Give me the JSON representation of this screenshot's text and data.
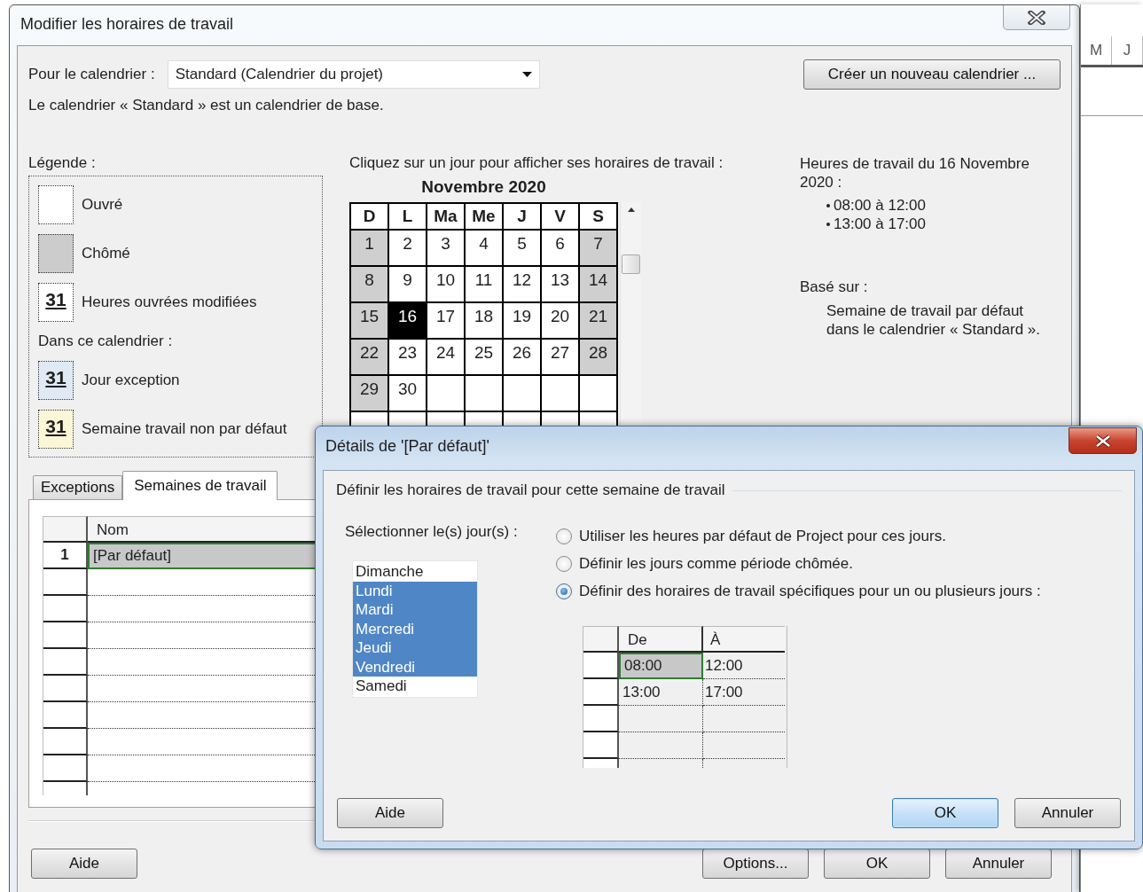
{
  "background_app": {
    "column_headers": [
      "M",
      "J"
    ]
  },
  "main_dialog": {
    "title": "Modifier les horaires de travail",
    "calendar_label": "Pour le calendrier :",
    "calendar_select": {
      "value": "Standard (Calendrier du projet)"
    },
    "new_calendar_button": "Créer un nouveau calendrier ...",
    "base_note": "Le calendrier « Standard » est un calendrier de base.",
    "legend": {
      "title": "Légende :",
      "items": [
        {
          "kind": "working",
          "label": "Ouvré"
        },
        {
          "kind": "nonworking",
          "label": "Chômé"
        },
        {
          "kind": "edited",
          "mark": "31",
          "label": "Heures ouvrées modifiées"
        },
        {
          "kind": "heading",
          "label": "Dans ce calendrier :"
        },
        {
          "kind": "exception",
          "mark": "31",
          "label": "Jour exception"
        },
        {
          "kind": "nondefault_week",
          "mark": "31",
          "label": "Semaine travail non par défaut"
        }
      ]
    },
    "calendar": {
      "prompt": "Cliquez sur un jour pour afficher ses horaires de travail :",
      "month": "Novembre 2020",
      "weekdays": [
        "D",
        "L",
        "Ma",
        "Me",
        "J",
        "V",
        "S"
      ],
      "weeks": [
        {
          "days": [
            {
              "day": "1",
              "nonworking": true,
              "selected": false
            },
            {
              "day": "2",
              "nonworking": false,
              "selected": false
            },
            {
              "day": "3",
              "nonworking": false,
              "selected": false
            },
            {
              "day": "4",
              "nonworking": false,
              "selected": false
            },
            {
              "day": "5",
              "nonworking": false,
              "selected": false
            },
            {
              "day": "6",
              "nonworking": false,
              "selected": false
            },
            {
              "day": "7",
              "nonworking": true,
              "selected": false
            }
          ]
        },
        {
          "days": [
            {
              "day": "8",
              "nonworking": true,
              "selected": false
            },
            {
              "day": "9",
              "nonworking": false,
              "selected": false
            },
            {
              "day": "10",
              "nonworking": false,
              "selected": false
            },
            {
              "day": "11",
              "nonworking": false,
              "selected": false
            },
            {
              "day": "12",
              "nonworking": false,
              "selected": false
            },
            {
              "day": "13",
              "nonworking": false,
              "selected": false
            },
            {
              "day": "14",
              "nonworking": true,
              "selected": false
            }
          ]
        },
        {
          "days": [
            {
              "day": "15",
              "nonworking": true,
              "selected": false
            },
            {
              "day": "16",
              "nonworking": false,
              "selected": true
            },
            {
              "day": "17",
              "nonworking": false,
              "selected": false
            },
            {
              "day": "18",
              "nonworking": false,
              "selected": false
            },
            {
              "day": "19",
              "nonworking": false,
              "selected": false
            },
            {
              "day": "20",
              "nonworking": false,
              "selected": false
            },
            {
              "day": "21",
              "nonworking": true,
              "selected": false
            }
          ]
        },
        {
          "days": [
            {
              "day": "22",
              "nonworking": true,
              "selected": false
            },
            {
              "day": "23",
              "nonworking": false,
              "selected": false
            },
            {
              "day": "24",
              "nonworking": false,
              "selected": false
            },
            {
              "day": "25",
              "nonworking": false,
              "selected": false
            },
            {
              "day": "26",
              "nonworking": false,
              "selected": false
            },
            {
              "day": "27",
              "nonworking": false,
              "selected": false
            },
            {
              "day": "28",
              "nonworking": true,
              "selected": false
            }
          ]
        },
        {
          "days": [
            {
              "day": "29",
              "nonworking": true,
              "selected": false
            },
            {
              "day": "30",
              "nonworking": false,
              "selected": false
            }
          ]
        }
      ]
    },
    "hours": {
      "title": "Heures de travail du 16 Novembre 2020 :",
      "ranges": [
        "08:00 à 12:00",
        "13:00 à 17:00"
      ],
      "based_on_label": "Basé sur :",
      "based_on": "Semaine de travail par défaut dans le calendrier « Standard »."
    },
    "tabs": [
      {
        "label": "Exceptions",
        "selected": false
      },
      {
        "label": "Semaines de travail",
        "selected": true
      }
    ],
    "table": {
      "columns": [
        "Nom"
      ],
      "rows": [
        {
          "number": "1",
          "name": "[Par défaut]",
          "selected": true
        }
      ]
    },
    "buttons": [
      {
        "label": "Aide",
        "default": false
      },
      {
        "label": "Options...",
        "default": false
      },
      {
        "label": "OK",
        "default": false
      },
      {
        "label": "Annuler",
        "default": false
      }
    ]
  },
  "details_dialog": {
    "title": "Détails de '[Par défaut]'",
    "group_title": "Définir les horaires de travail pour cette semaine de travail",
    "days_label": "Sélectionner le(s) jour(s) :",
    "days": [
      {
        "label": "Dimanche",
        "selected": false
      },
      {
        "label": "Lundi",
        "selected": true
      },
      {
        "label": "Mardi",
        "selected": true
      },
      {
        "label": "Mercredi",
        "selected": true
      },
      {
        "label": "Jeudi",
        "selected": true
      },
      {
        "label": "Vendredi",
        "selected": true
      },
      {
        "label": "Samedi",
        "selected": false
      }
    ],
    "options": [
      {
        "label": "Utiliser les heures par défaut de Project pour ces jours.",
        "selected": false
      },
      {
        "label": "Définir les jours comme période chômée.",
        "selected": false
      },
      {
        "label": "Définir des horaires de travail spécifiques pour un ou plusieurs jours :",
        "selected": true
      }
    ],
    "times": {
      "columns": [
        "De",
        "À"
      ],
      "rows": [
        {
          "from": "08:00",
          "to": "12:00",
          "selected": true
        },
        {
          "from": "13:00",
          "to": "17:00",
          "selected": false
        }
      ]
    },
    "buttons": [
      {
        "label": "Aide",
        "default": false
      },
      {
        "label": "OK",
        "default": true
      },
      {
        "label": "Annuler",
        "default": false
      }
    ]
  }
}
